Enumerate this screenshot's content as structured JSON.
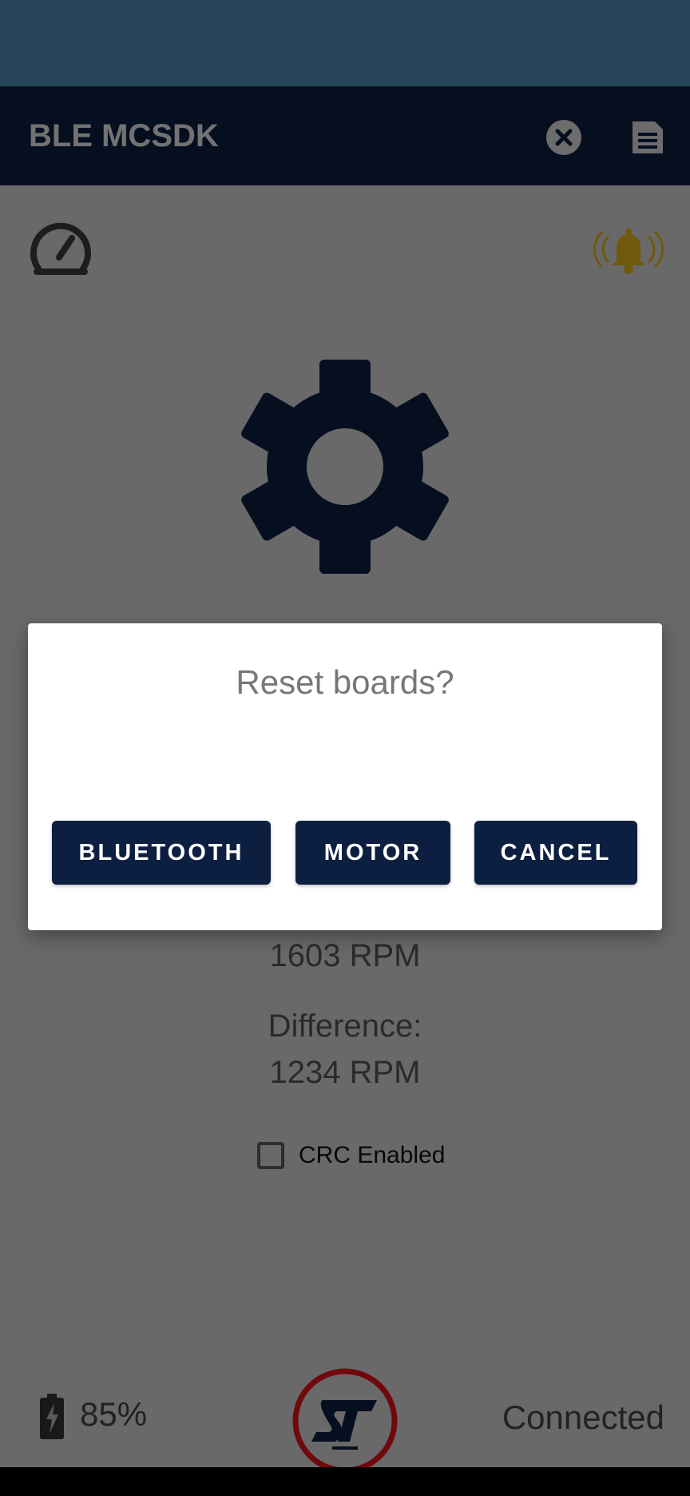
{
  "app_bar": {
    "title": "BLE MCSDK",
    "close_icon": "close-circle-icon",
    "doc_icon": "document-icon"
  },
  "main": {
    "speedometer_icon": "speedometer-icon",
    "alarm_icon": "ringing-bell-icon",
    "settings_icon": "gear-icon",
    "actual_speed_value": "1603 RPM",
    "difference_label": "Difference:",
    "difference_value": "1234 RPM",
    "crc_label": "CRC Enabled",
    "crc_checked": false
  },
  "footer": {
    "battery_level": "85%",
    "logo_icon": "st-logo-icon",
    "connection_status": "Connected"
  },
  "dialog": {
    "title": "Reset boards?",
    "buttons": {
      "bluetooth": "BLUETOOTH",
      "motor": "MOTOR",
      "cancel": "CANCEL"
    }
  },
  "colors": {
    "app_bar": "#0d1f40",
    "status_bar": "#4e8ab0",
    "alarm_bell": "#e0b21b",
    "highlight_ring": "#e0101a",
    "button_bg": "#0d1f40"
  }
}
